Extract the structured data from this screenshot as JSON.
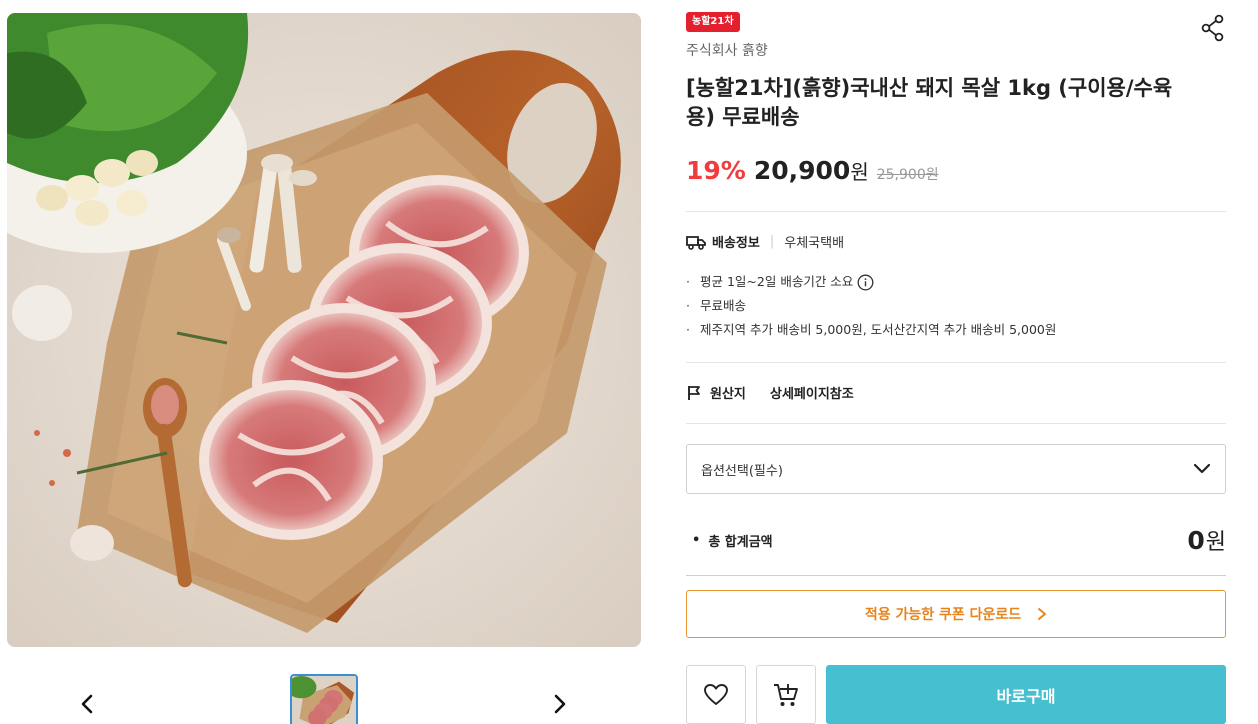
{
  "product": {
    "badge": "농할21차",
    "seller": "주식회사 흙향",
    "title": "[농할21차](흙향)국내산 돼지 목살 1kg (구이용/수육용) 무료배송",
    "discount": "19%",
    "sale_price": "20,900",
    "price_unit": "원",
    "original_price": "25,900원"
  },
  "shipping": {
    "label": "배송정보",
    "method": "우체국택배",
    "bullets": [
      "평균 1일~2일 배송기간 소요",
      "무료배송",
      "제주지역 추가 배송비 5,000원, 도서산간지역 추가 배송비 5,000원"
    ]
  },
  "origin": {
    "label": "원산지",
    "value": "상세페이지참조"
  },
  "option": {
    "placeholder": "옵션선택(필수)"
  },
  "total": {
    "label": "총 합계금액",
    "value": "0",
    "unit": "원"
  },
  "coupon": {
    "label": "적용 가능한 쿠폰 다운로드"
  },
  "actions": {
    "buy_label": "바로구매"
  },
  "colors": {
    "badge": "#e5202e",
    "discount": "#f03c3c",
    "coupon": "#e8831a",
    "buy_button": "#46bfd0",
    "thumb_border": "#3b8fd6"
  },
  "icons": [
    "share-icon",
    "truck-icon",
    "info-icon",
    "flag-icon",
    "chevron-down-icon",
    "chevron-right-icon",
    "heart-icon",
    "cart-add-icon",
    "arrow-left-icon",
    "arrow-right-icon"
  ]
}
